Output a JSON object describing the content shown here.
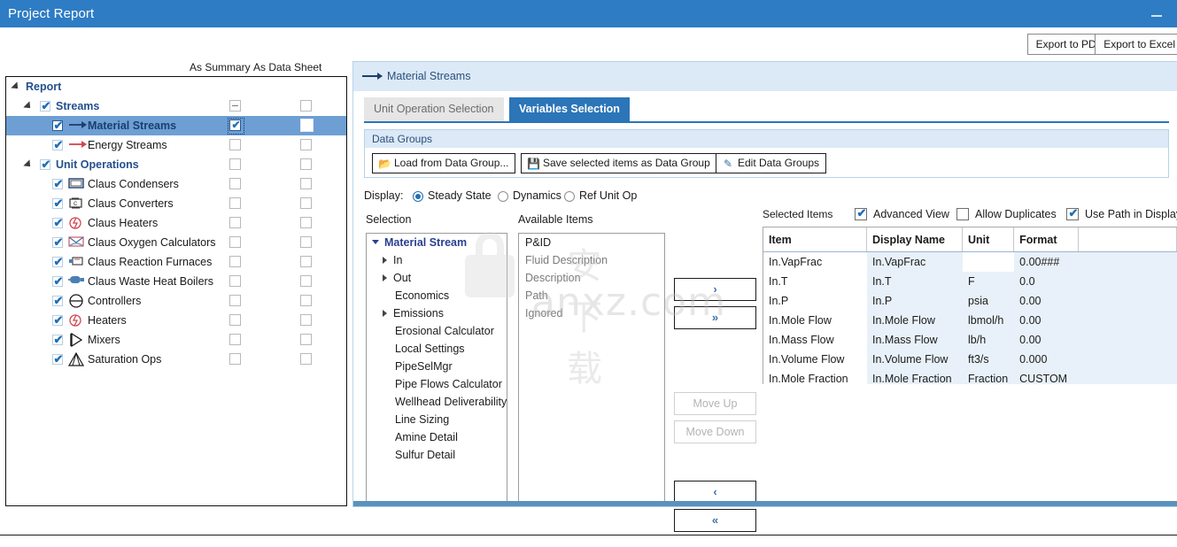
{
  "window": {
    "title": "Project Report",
    "minimize_icon": "minimize-icon"
  },
  "toolbar": {
    "export_pdf": "Export to PDF",
    "export_excel": "Export to Excel"
  },
  "tree_panel": {
    "column_headers": [
      "As Summary",
      "As Data Sheet"
    ],
    "rows": [
      {
        "label": "Report",
        "indent": 0,
        "kind": "root",
        "expander": "down",
        "checked": null,
        "icon": null,
        "summary": null,
        "datasheet": null,
        "selected": false
      },
      {
        "label": "Streams",
        "indent": 1,
        "kind": "group",
        "expander": "down",
        "checked": true,
        "icon": null,
        "summary": "dash",
        "datasheet": "off",
        "selected": false
      },
      {
        "label": "Material Streams",
        "indent": 2,
        "kind": "item",
        "expander": null,
        "checked": true,
        "icon": "arrow-blue-icon",
        "summary": "checked",
        "datasheet": "off",
        "selected": true
      },
      {
        "label": "Energy Streams",
        "indent": 2,
        "kind": "item",
        "expander": null,
        "checked": true,
        "icon": "arrow-red-icon",
        "summary": "off",
        "datasheet": "off",
        "selected": false
      },
      {
        "label": "Unit Operations",
        "indent": 1,
        "kind": "group",
        "expander": "down",
        "checked": true,
        "icon": null,
        "summary": "off",
        "datasheet": "off",
        "selected": false
      },
      {
        "label": "Claus Condensers",
        "indent": 2,
        "kind": "item",
        "expander": null,
        "checked": true,
        "icon": "condenser-icon",
        "summary": "off",
        "datasheet": "off",
        "selected": false
      },
      {
        "label": "Claus Converters",
        "indent": 2,
        "kind": "item",
        "expander": null,
        "checked": true,
        "icon": "converter-icon",
        "summary": "off",
        "datasheet": "off",
        "selected": false
      },
      {
        "label": "Claus Heaters",
        "indent": 2,
        "kind": "item",
        "expander": null,
        "checked": true,
        "icon": "heater-icon",
        "summary": "off",
        "datasheet": "off",
        "selected": false
      },
      {
        "label": "Claus Oxygen Calculators",
        "indent": 2,
        "kind": "item",
        "expander": null,
        "checked": true,
        "icon": "oxygen-calc-icon",
        "summary": "off",
        "datasheet": "off",
        "selected": false
      },
      {
        "label": "Claus Reaction Furnaces",
        "indent": 2,
        "kind": "item",
        "expander": null,
        "checked": true,
        "icon": "furnace-icon",
        "summary": "off",
        "datasheet": "off",
        "selected": false
      },
      {
        "label": "Claus Waste Heat Boilers",
        "indent": 2,
        "kind": "item",
        "expander": null,
        "checked": true,
        "icon": "boiler-icon",
        "summary": "off",
        "datasheet": "off",
        "selected": false
      },
      {
        "label": "Controllers",
        "indent": 2,
        "kind": "item",
        "expander": null,
        "checked": true,
        "icon": "controller-icon",
        "summary": "off",
        "datasheet": "off",
        "selected": false
      },
      {
        "label": "Heaters",
        "indent": 2,
        "kind": "item",
        "expander": null,
        "checked": true,
        "icon": "heater-icon",
        "summary": "off",
        "datasheet": "off",
        "selected": false
      },
      {
        "label": "Mixers",
        "indent": 2,
        "kind": "item",
        "expander": null,
        "checked": true,
        "icon": "mixer-icon",
        "summary": "off",
        "datasheet": "off",
        "selected": false
      },
      {
        "label": "Saturation Ops",
        "indent": 2,
        "kind": "item",
        "expander": null,
        "checked": true,
        "icon": "saturation-icon",
        "summary": "off",
        "datasheet": "off",
        "selected": false
      }
    ]
  },
  "right_panel": {
    "header_title": "Material Streams",
    "tabs": [
      {
        "label": "Unit Operation Selection",
        "active": false
      },
      {
        "label": "Variables Selection",
        "active": true
      }
    ],
    "data_groups": {
      "title": "Data Groups",
      "buttons": [
        {
          "label": "Load from Data Group...",
          "icon": "open-folder-icon"
        },
        {
          "label": "Save selected items as Data Group",
          "icon": "save-disk-icon"
        },
        {
          "label": "Edit Data Groups",
          "icon": "edit-pencil-icon"
        }
      ]
    },
    "display": {
      "label": "Display:",
      "options": [
        {
          "label": "Steady State",
          "selected": true
        },
        {
          "label": "Dynamics",
          "selected": false
        },
        {
          "label": "Ref Unit Op",
          "selected": false
        }
      ]
    },
    "selection": {
      "header": "Selection",
      "items": [
        {
          "label": "Material Stream",
          "level": "root"
        },
        {
          "label": "In",
          "level": "node"
        },
        {
          "label": "Out",
          "level": "node"
        },
        {
          "label": "Economics",
          "level": "leaf"
        },
        {
          "label": "Emissions",
          "level": "node"
        },
        {
          "label": "Erosional Calculator",
          "level": "leaf"
        },
        {
          "label": "Local Settings",
          "level": "leaf"
        },
        {
          "label": "PipeSelMgr",
          "level": "leaf"
        },
        {
          "label": "Pipe Flows Calculator",
          "level": "leaf"
        },
        {
          "label": "Wellhead Deliverability",
          "level": "leaf"
        },
        {
          "label": "Line Sizing",
          "level": "leaf"
        },
        {
          "label": "Amine Detail",
          "level": "leaf"
        },
        {
          "label": "Sulfur Detail",
          "level": "leaf"
        }
      ]
    },
    "available": {
      "header": "Available Items",
      "items": [
        {
          "label": "P&ID",
          "muted": false
        },
        {
          "label": "Fluid Description",
          "muted": true
        },
        {
          "label": "Description",
          "muted": true
        },
        {
          "label": "Path",
          "muted": true
        },
        {
          "label": "Ignored",
          "muted": true
        }
      ]
    },
    "move_buttons": [
      {
        "label": "›",
        "name": "move-right-button",
        "state": "enabled"
      },
      {
        "label": "»",
        "name": "move-all-right-button",
        "state": "enabled"
      },
      {
        "label": "Move Up",
        "name": "move-up-button",
        "state": "disabled"
      },
      {
        "label": "Move Down",
        "name": "move-down-button",
        "state": "disabled"
      },
      {
        "label": "‹",
        "name": "move-left-button",
        "state": "enabled"
      },
      {
        "label": "«",
        "name": "move-all-left-button",
        "state": "enabled"
      }
    ],
    "selected_items": {
      "header": "Selected Items",
      "checkboxes": [
        {
          "label": "Advanced View",
          "checked": true
        },
        {
          "label": "Allow Duplicates",
          "checked": false
        },
        {
          "label": "Use Path in Display",
          "checked": true
        }
      ],
      "columns": [
        "Item",
        "Display Name",
        "Unit",
        "Format",
        ""
      ],
      "rows": [
        {
          "item": "In.VapFrac",
          "display_name": "In.VapFrac",
          "unit": "",
          "format": "0.00###"
        },
        {
          "item": "In.T",
          "display_name": "In.T",
          "unit": "F",
          "format": "0.0"
        },
        {
          "item": "In.P",
          "display_name": "In.P",
          "unit": "psia",
          "format": "0.00"
        },
        {
          "item": "In.Mole Flow",
          "display_name": "In.Mole Flow",
          "unit": "lbmol/h",
          "format": "0.00"
        },
        {
          "item": "In.Mass Flow",
          "display_name": "In.Mass Flow",
          "unit": "lb/h",
          "format": "0.00"
        },
        {
          "item": "In.Volume Flow",
          "display_name": "In.Volume Flow",
          "unit": "ft3/s",
          "format": "0.000"
        },
        {
          "item": "In.Mole Fraction",
          "display_name": "In.Mole Fraction",
          "unit": "Fraction",
          "format": "CUSTOM"
        }
      ]
    }
  },
  "watermark": {
    "text": "anxz.com",
    "cn_text": "安下载"
  },
  "colors": {
    "titlebar": "#2e7cc4",
    "accent": "#2b75b8",
    "selection": "#6d9ed4",
    "panel_header": "#dce9f6",
    "grid_alt": "#e8f1f9"
  }
}
